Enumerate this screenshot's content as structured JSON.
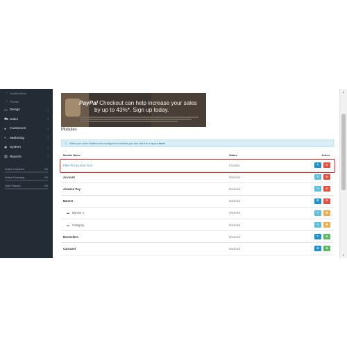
{
  "sidebar": {
    "subitems": [
      {
        "label": "Modifications"
      },
      {
        "label": "Events"
      }
    ],
    "items": [
      {
        "label": "Design",
        "icon": "desktop-icon"
      },
      {
        "label": "Sales",
        "icon": "cart-icon"
      },
      {
        "label": "Customers",
        "icon": "user-icon"
      },
      {
        "label": "Marketing",
        "icon": "share-icon"
      },
      {
        "label": "System",
        "icon": "cog-icon"
      },
      {
        "label": "Reports",
        "icon": "bar-chart-icon"
      }
    ],
    "stats": [
      {
        "label": "Orders Completed",
        "value": "0%",
        "progress": 0
      },
      {
        "label": "Orders Processing",
        "value": "0%",
        "progress": 0
      },
      {
        "label": "Other Statuses",
        "value": "0%",
        "progress": 0
      }
    ]
  },
  "banner": {
    "brand": "PayPal",
    "headline_1": "Checkout can help increase your sales",
    "headline_2": "by up to 43%*. Sign up today."
  },
  "modules": {
    "title": "Modules",
    "alert_text": "When you have installed and configured a module you can add it to a layout",
    "alert_link": "here!",
    "columns": {
      "name": "Module Name",
      "status": "Status",
      "action": "Action"
    },
    "rows": [
      {
        "name": "Filter Pro by Aura Tech",
        "status": "Enabled",
        "style": "link",
        "buttons": [
          "edit-blue",
          "uninstall-red"
        ]
      },
      {
        "name": "Account",
        "status": "Disabled",
        "style": "bold",
        "buttons": [
          "edit-lblue",
          "uninstall-red"
        ]
      },
      {
        "name": "Amazon Pay",
        "status": "Disabled",
        "style": "bold",
        "buttons": [
          "edit-lblue",
          "uninstall-red"
        ]
      },
      {
        "name": "Banner",
        "status": "Disabled",
        "style": "bold",
        "buttons": [
          "add-blue",
          "uninstall-red"
        ]
      },
      {
        "name": "Banner 1",
        "status": "Disabled",
        "style": "child",
        "buttons": [
          "edit-lblue",
          "delete-orange"
        ]
      },
      {
        "name": "Category",
        "status": "Disabled",
        "style": "child",
        "buttons": [
          "edit-lblue",
          "delete-orange"
        ]
      },
      {
        "name": "Bestsellers",
        "status": "Disabled",
        "style": "bold",
        "buttons": [
          "edit-blue",
          "install-green"
        ]
      },
      {
        "name": "Carousel",
        "status": "Disabled",
        "style": "bold",
        "buttons": [
          "add-blue",
          "install-green"
        ]
      }
    ]
  },
  "colors": {
    "sidebar_bg": "#232b35",
    "highlight": "#e02a2a",
    "link": "#3c8dbc"
  }
}
